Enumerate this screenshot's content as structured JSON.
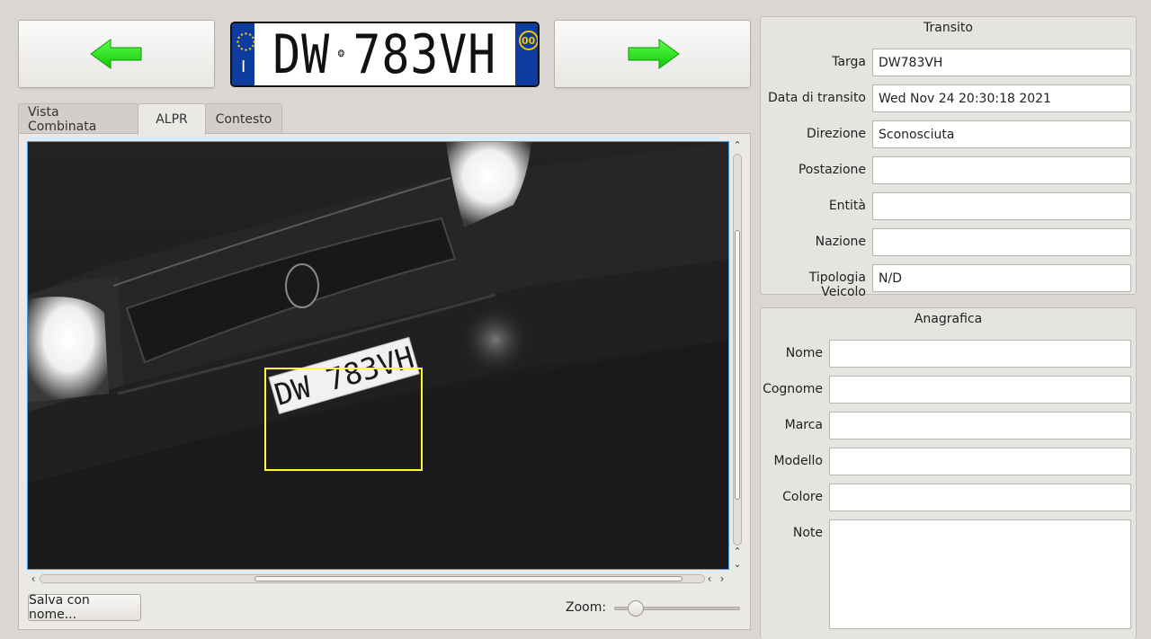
{
  "navigation": {
    "prev_icon": "green-left-arrow-icon",
    "next_icon": "green-right-arrow-icon",
    "arrow_color": "#1fe015"
  },
  "plate_banner": {
    "left_part": "DW",
    "right_part": "783VH",
    "country_code": "I",
    "province_badge": "00"
  },
  "tabs": [
    {
      "label": "Vista Combinata"
    },
    {
      "label": "ALPR"
    },
    {
      "label": "Contesto"
    }
  ],
  "active_tab": 1,
  "viewer": {
    "plate_text": "DW 783VH",
    "highlight_color": "#ffff33"
  },
  "actions": {
    "save_label": "Salva con nome..."
  },
  "zoom": {
    "label": "Zoom:",
    "level": 0.12
  },
  "transito": {
    "title": "Transito",
    "fields": [
      {
        "label": "Targa",
        "value": "DW783VH"
      },
      {
        "label": "Data di transito",
        "value": "Wed Nov 24 20:30:18 2021"
      },
      {
        "label": "Direzione",
        "value": "Sconosciuta"
      },
      {
        "label": "Postazione",
        "value": ""
      },
      {
        "label": "Entità",
        "value": ""
      },
      {
        "label": "Nazione",
        "value": ""
      },
      {
        "label": "Tipologia Veicolo",
        "value": "N/D"
      }
    ]
  },
  "anagrafica": {
    "title": "Anagrafica",
    "fields": [
      {
        "label": "Nome",
        "value": ""
      },
      {
        "label": "Cognome",
        "value": ""
      },
      {
        "label": "Marca",
        "value": ""
      },
      {
        "label": "Modello",
        "value": ""
      },
      {
        "label": "Colore",
        "value": ""
      },
      {
        "label": "Note",
        "value": ""
      }
    ]
  }
}
